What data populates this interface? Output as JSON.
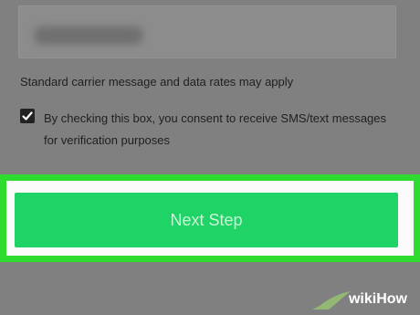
{
  "phone_input": {
    "value": "",
    "blurred": true
  },
  "carrier_note": "Standard carrier message and data rates may apply",
  "consent": {
    "checked": true,
    "text": "By checking this box, you consent to receive SMS/text messages for verification purposes"
  },
  "next_button": {
    "label": "Next Step"
  },
  "watermark": {
    "text": "wikiHow"
  },
  "colors": {
    "highlight": "#2ddc2f",
    "button": "#20d366",
    "button_text": "#c9f5d9"
  }
}
